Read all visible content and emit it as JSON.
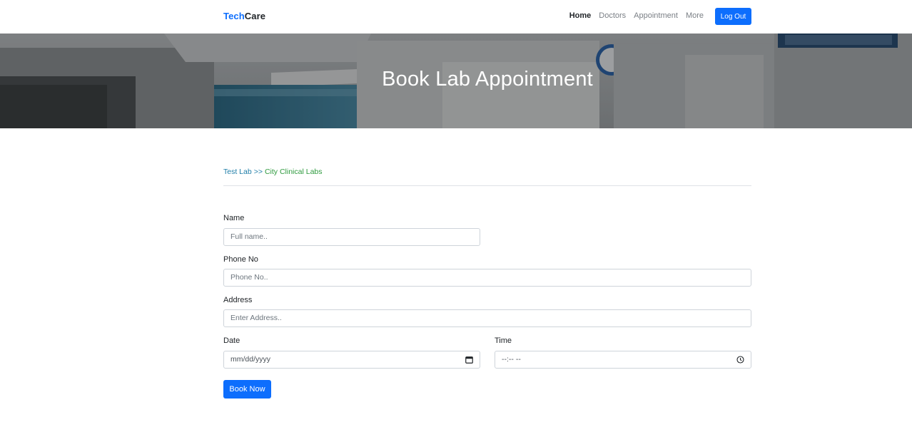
{
  "brand": {
    "part1": "Tech",
    "part2": "Care"
  },
  "nav": {
    "items": [
      {
        "label": "Home"
      },
      {
        "label": "Doctors"
      },
      {
        "label": "Appointment"
      },
      {
        "label": "More"
      }
    ],
    "logout_label": "Log Out"
  },
  "hero": {
    "title": "Book Lab Appointment"
  },
  "breadcrumb": {
    "first": "Test Lab",
    "separator": ">>",
    "second": "City Clinical Labs"
  },
  "form": {
    "name": {
      "label": "Name",
      "placeholder": "Full name.."
    },
    "phone": {
      "label": "Phone No",
      "placeholder": "Phone No.."
    },
    "address": {
      "label": "Address",
      "placeholder": "Enter Address.."
    },
    "date": {
      "label": "Date",
      "placeholder": "mm/dd/yyyy"
    },
    "time": {
      "label": "Time",
      "placeholder": "--:-- --"
    },
    "submit_label": "Book Now"
  },
  "colors": {
    "accent": "#0d6efd",
    "breadcrumb_link": "#1f7ea8",
    "breadcrumb_current": "#2e9a3e"
  }
}
